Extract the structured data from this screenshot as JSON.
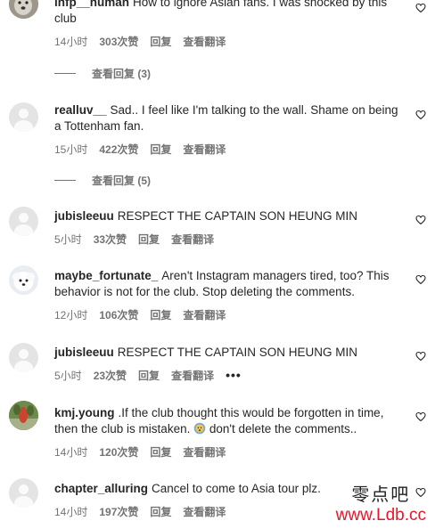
{
  "comments": [
    {
      "username": "infp__human",
      "text": "How to ignore Asian fans. I was shocked by this club",
      "time": "14小时",
      "likes": "303次赞",
      "reply_label": "回复",
      "translate_label": "查看翻译",
      "view_replies": "查看回复 (3)",
      "avatar": "dog-photo"
    },
    {
      "username": "realluv__",
      "text": "Sad.. I feel like I'm talking to the wall. Shame on being a Tottenham fan.",
      "time": "15小时",
      "likes": "422次赞",
      "reply_label": "回复",
      "translate_label": "查看翻译",
      "view_replies": "查看回复 (5)",
      "avatar": "default"
    },
    {
      "username": "jubisleeuu",
      "text": "RESPECT THE CAPTAIN SON HEUNG MIN",
      "time": "5小时",
      "likes": "33次赞",
      "reply_label": "回复",
      "translate_label": "查看翻译",
      "avatar": "default"
    },
    {
      "username": "maybe_fortunate_",
      "text": "Aren't Instagram managers tired, too? This behavior is not for the club. Stop deleting the comments.",
      "time": "12小时",
      "likes": "106次赞",
      "reply_label": "回复",
      "translate_label": "查看翻译",
      "avatar": "white-dog"
    },
    {
      "username": "jubisleeuu",
      "text": "RESPECT THE CAPTAIN SON HEUNG MIN",
      "time": "5小时",
      "likes": "23次赞",
      "reply_label": "回复",
      "translate_label": "查看翻译",
      "more": "•••",
      "avatar": "default"
    },
    {
      "username": "kmj.young",
      "text_before_emoji": ".If the club thought this would be forgotten in time, then the club is mistaken.",
      "text_after_emoji": " don't delete the comments..",
      "emoji": "anxious-face-emoji",
      "time": "14小时",
      "likes": "120次赞",
      "reply_label": "回复",
      "translate_label": "查看翻译",
      "avatar": "plant-photo"
    },
    {
      "username": "chapter_alluring",
      "text": "Cancel to come to Asia tour plz.",
      "time": "14小时",
      "likes": "197次赞",
      "reply_label": "回复",
      "translate_label": "查看翻译",
      "avatar": "default"
    }
  ],
  "watermark": {
    "line1": "零点吧",
    "line2": "www.Ldb.cc"
  },
  "colors": {
    "text": "#262626",
    "meta": "#737373",
    "watermark_red": "#e5162a"
  },
  "icons": {
    "like": "heart-icon",
    "more": "more-options-icon"
  }
}
